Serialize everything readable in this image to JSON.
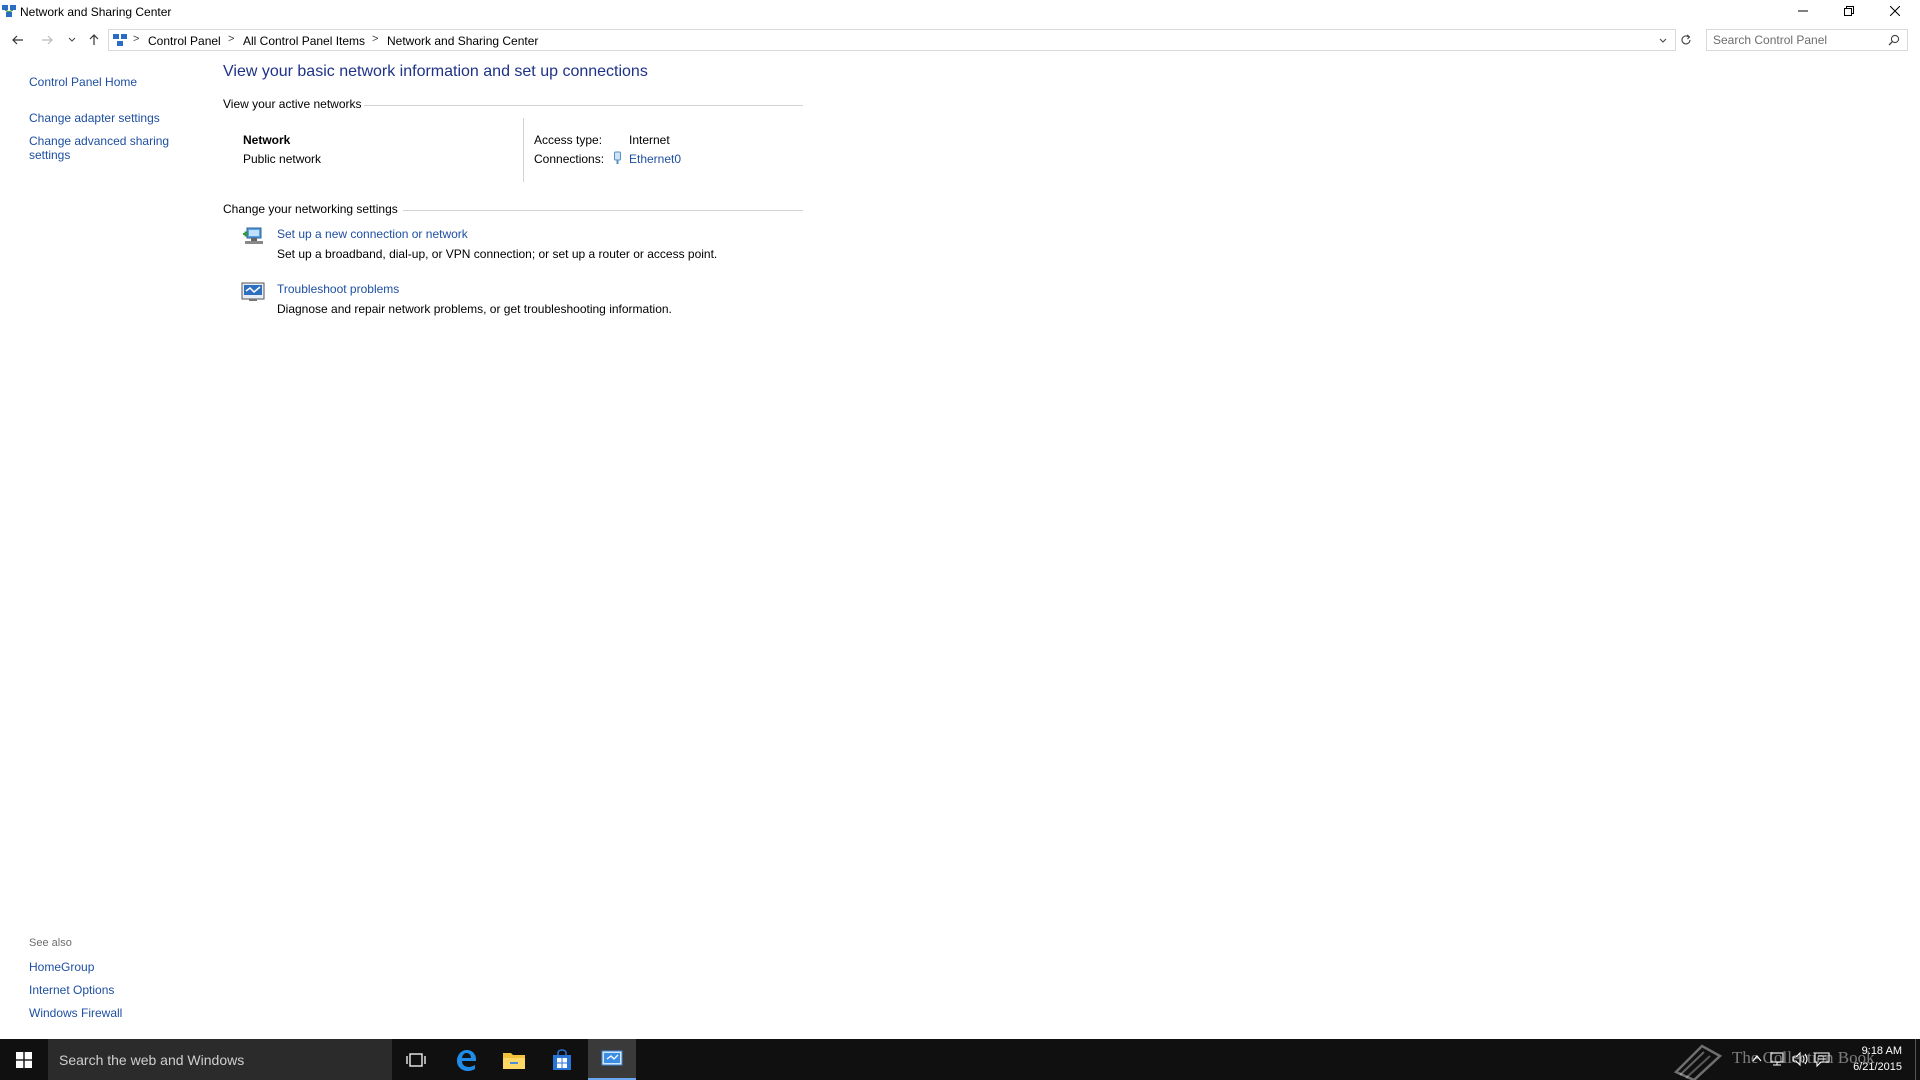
{
  "window": {
    "title": "Network and Sharing Center"
  },
  "address": {
    "crumbs": [
      "Control Panel",
      "All Control Panel Items",
      "Network and Sharing Center"
    ],
    "search_placeholder": "Search Control Panel"
  },
  "left_pane": {
    "home": "Control Panel Home",
    "adapter": "Change adapter settings",
    "advanced_line1": "Change advanced sharing",
    "advanced_line2": "settings",
    "see_also": "See also",
    "see_also_links": [
      "HomeGroup",
      "Internet Options",
      "Windows Firewall"
    ]
  },
  "main": {
    "heading": "View your basic network information and set up connections",
    "active_networks_label": "View your active networks",
    "network": {
      "name": "Network",
      "type": "Public network",
      "access_type_label": "Access type:",
      "access_type_value": "Internet",
      "connections_label": "Connections:",
      "connection_value": "Ethernet0"
    },
    "change_settings_label": "Change your networking settings",
    "tasks": [
      {
        "title": "Set up a new connection or network",
        "description": "Set up a broadband, dial-up, or VPN connection; or set up a router or access point."
      },
      {
        "title": "Troubleshoot problems",
        "description": "Diagnose and repair network problems, or get troubleshooting information."
      }
    ]
  },
  "taskbar": {
    "search_text": "Search the web and Windows",
    "watermark": "The Collection Book",
    "time": "9:18 AM",
    "date": "6/21/2015"
  },
  "colors": {
    "link": "#1e4fa1",
    "heading": "#1e3287",
    "taskbar": "#101010"
  }
}
